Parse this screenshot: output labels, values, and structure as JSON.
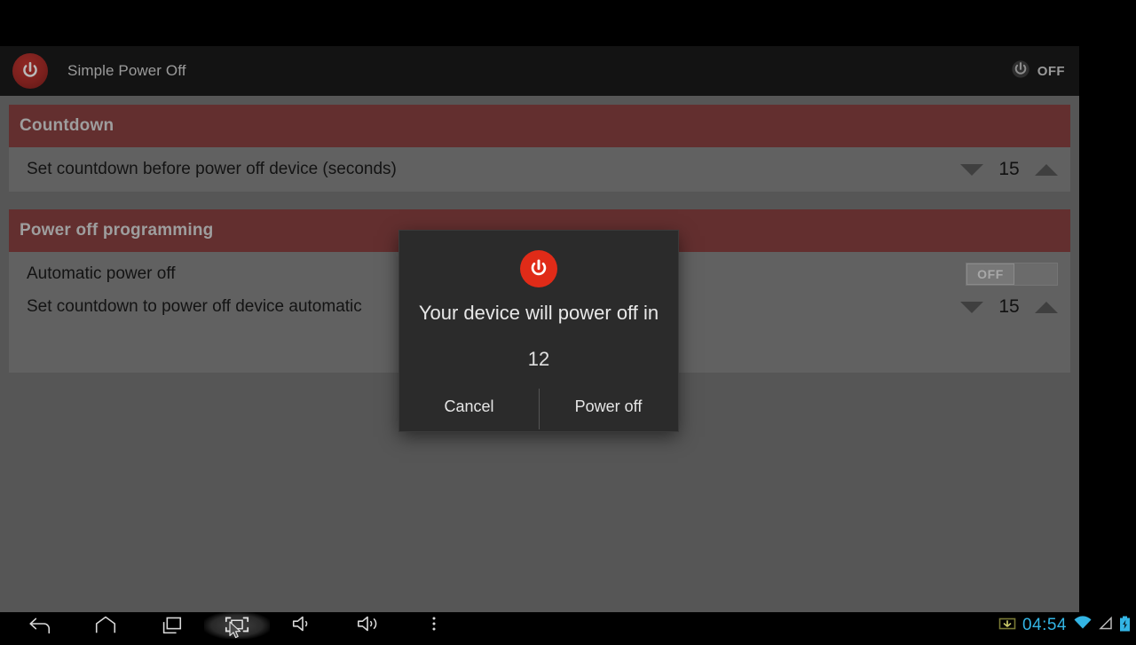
{
  "app": {
    "title": "Simple Power Off",
    "logo_icon": "power-icon",
    "toggle": {
      "icon": "power-icon",
      "label": "OFF"
    }
  },
  "sections": [
    {
      "header": "Countdown",
      "rows": [
        {
          "title": "Set countdown before power off device (seconds)",
          "control": "number-picker",
          "value": "15",
          "decrement_icon": "triangle-down-icon",
          "increment_icon": "triangle-up-icon"
        }
      ]
    },
    {
      "header": "Power off programming",
      "rows": [
        {
          "title": "Automatic power off",
          "control": "switch",
          "value": "OFF"
        },
        {
          "title": "Set countdown to power off device automatic",
          "control": "number-picker",
          "value": "15",
          "decrement_icon": "triangle-down-icon",
          "increment_icon": "triangle-up-icon"
        }
      ]
    }
  ],
  "dialog": {
    "icon": "power-icon",
    "message": "Your device will power off in",
    "countdown": "12",
    "cancel_label": "Cancel",
    "confirm_label": "Power off"
  },
  "navbar": {
    "buttons": [
      {
        "name": "back-icon"
      },
      {
        "name": "home-icon"
      },
      {
        "name": "recents-icon"
      },
      {
        "name": "screenshot-icon"
      },
      {
        "name": "volume-down-icon"
      },
      {
        "name": "volume-up-icon"
      },
      {
        "name": "overflow-menu-icon"
      }
    ],
    "status": {
      "download_icon": "download-icon",
      "clock": "04:54",
      "wifi_icon": "wifi-icon",
      "signal_icon": "signal-icon",
      "battery_icon": "battery-charging-icon"
    }
  },
  "colors": {
    "section_header": "#632f2f",
    "row_background": "#616161",
    "page_background": "#565656",
    "appbar": "#131313",
    "dialog_background": "#2b2b2b",
    "dialog_icon": "#e02b18",
    "clock": "#33b5e5"
  }
}
